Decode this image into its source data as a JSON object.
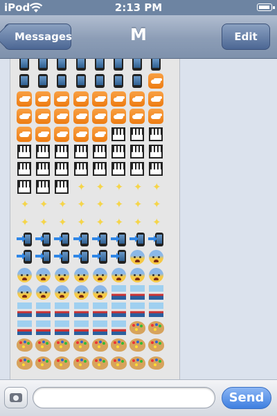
{
  "status_bar": {
    "carrier": "iPod",
    "time": "2:13 PM",
    "wifi_icon": "wifi-icon",
    "battery_icon": "battery-icon",
    "bar_color": "#6d84a2"
  },
  "nav": {
    "back_label": "Messages",
    "title": "M",
    "edit_label": "Edit"
  },
  "message": {
    "emoji_rows": [
      [
        "ipad-icon",
        "ipad-icon",
        "ipad-icon",
        "ipad-icon",
        "ipad-icon",
        "ipad-icon",
        "ipad-icon",
        "ipad-icon"
      ],
      [
        "ipad-icon",
        "ipad-icon",
        "ipad-icon",
        "ipad-icon",
        "ipad-icon",
        "ipad-icon",
        "ipad-icon",
        "cloud-icon"
      ],
      [
        "cloud-icon",
        "cloud-icon",
        "cloud-icon",
        "cloud-icon",
        "cloud-icon",
        "cloud-icon",
        "cloud-icon",
        "cloud-icon"
      ],
      [
        "cloud-icon",
        "cloud-icon",
        "cloud-icon",
        "cloud-icon",
        "cloud-icon",
        "cloud-icon",
        "cloud-icon",
        "cloud-icon"
      ],
      [
        "cloud-icon",
        "cloud-icon",
        "cloud-icon",
        "cloud-icon",
        "cloud-icon",
        "piano-icon",
        "piano-icon",
        "piano-icon"
      ],
      [
        "piano-icon",
        "piano-icon",
        "piano-icon",
        "piano-icon",
        "piano-icon",
        "piano-icon",
        "piano-icon",
        "piano-icon"
      ],
      [
        "piano-icon",
        "piano-icon",
        "piano-icon",
        "piano-icon",
        "piano-icon",
        "piano-icon",
        "piano-icon",
        "piano-icon"
      ],
      [
        "piano-icon",
        "piano-icon",
        "piano-icon",
        "sparkles-icon",
        "sparkles-icon",
        "sparkles-icon",
        "sparkles-icon",
        "sparkles-icon"
      ],
      [
        "sparkles-icon",
        "sparkles-icon",
        "sparkles-icon",
        "sparkles-icon",
        "sparkles-icon",
        "sparkles-icon",
        "sparkles-icon",
        "sparkles-icon"
      ],
      [
        "sparkles-icon",
        "sparkles-icon",
        "sparkles-icon",
        "sparkles-icon",
        "sparkles-icon",
        "sparkles-icon",
        "sparkles-icon",
        "sparkles-icon"
      ],
      [
        "ipad-arrow-icon",
        "ipad-arrow-icon",
        "ipad-arrow-icon",
        "ipad-arrow-icon",
        "ipad-arrow-icon",
        "ipad-arrow-icon",
        "ipad-arrow-icon",
        "ipad-arrow-icon"
      ],
      [
        "ipad-arrow-icon",
        "ipad-arrow-icon",
        "ipad-arrow-icon",
        "ipad-arrow-icon",
        "ipad-arrow-icon",
        "ipad-arrow-icon",
        "fearful-face-icon",
        "fearful-face-icon"
      ],
      [
        "fearful-face-icon",
        "fearful-face-icon",
        "fearful-face-icon",
        "fearful-face-icon",
        "fearful-face-icon",
        "fearful-face-icon",
        "fearful-face-icon",
        "fearful-face-icon"
      ],
      [
        "fearful-face-icon",
        "fearful-face-icon",
        "fearful-face-icon",
        "fearful-face-icon",
        "fearful-face-icon",
        "ship-icon",
        "ship-icon",
        "ship-icon"
      ],
      [
        "ship-icon",
        "ship-icon",
        "ship-icon",
        "ship-icon",
        "ship-icon",
        "ship-icon",
        "ship-icon",
        "ship-icon"
      ],
      [
        "ship-icon",
        "ship-icon",
        "ship-icon",
        "ship-icon",
        "ship-icon",
        "ship-icon",
        "palette-icon",
        "palette-icon"
      ],
      [
        "palette-icon",
        "palette-icon",
        "palette-icon",
        "palette-icon",
        "palette-icon",
        "palette-icon",
        "palette-icon",
        "palette-icon"
      ],
      [
        "palette-icon",
        "palette-icon",
        "palette-icon",
        "palette-icon",
        "palette-icon",
        "palette-icon",
        "palette-icon",
        "palette-icon"
      ]
    ]
  },
  "compose": {
    "camera_icon": "camera-icon",
    "input_value": "",
    "send_label": "Send",
    "send_color": "#3e7fe0"
  }
}
